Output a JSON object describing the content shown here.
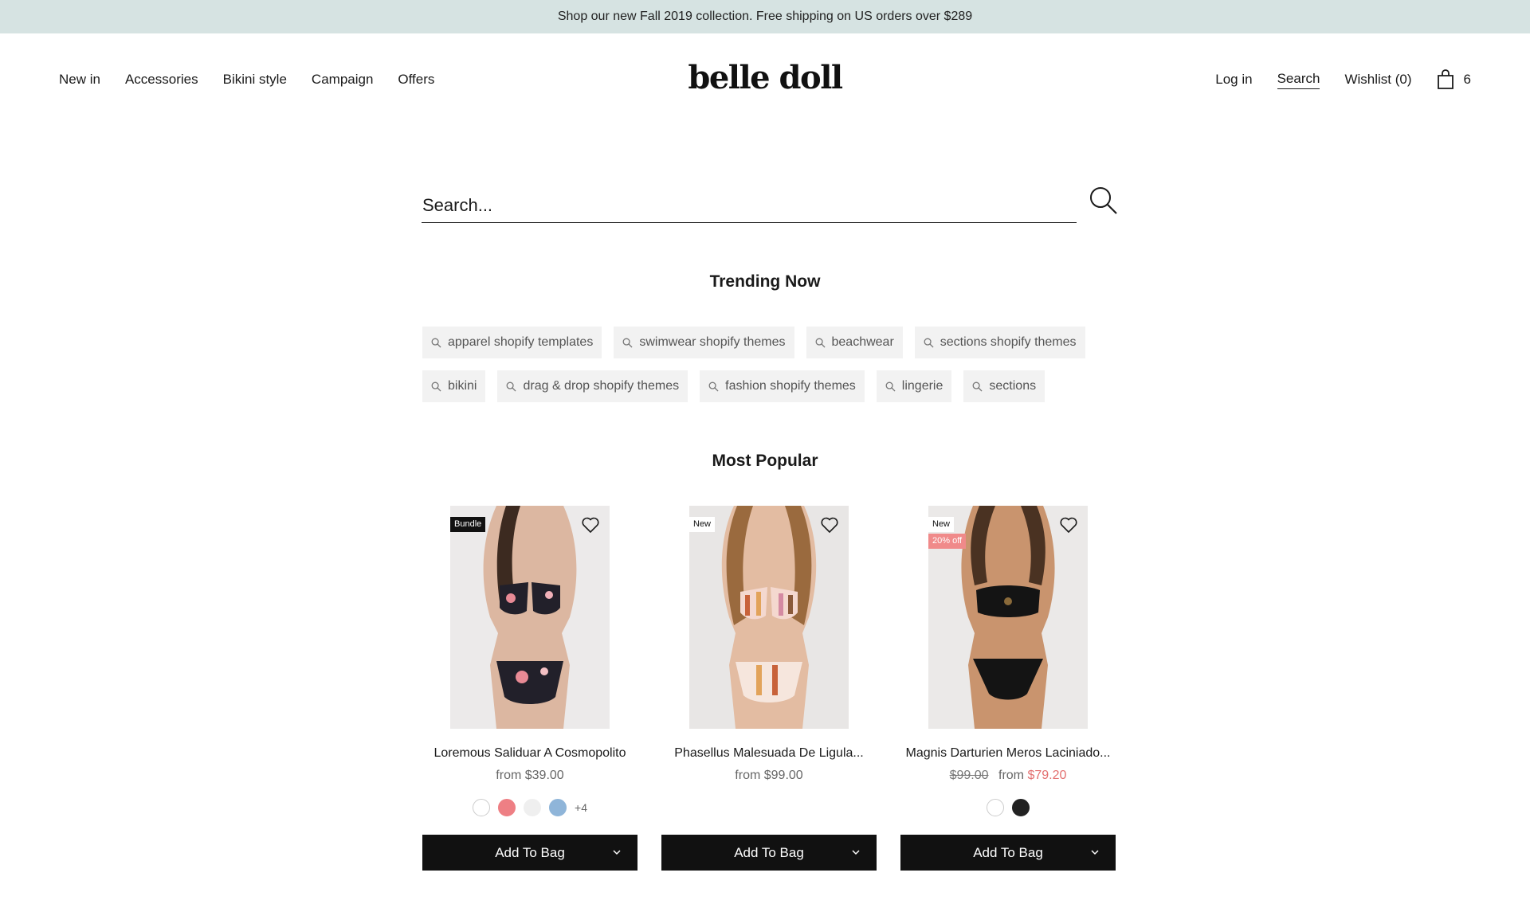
{
  "announcement": "Shop our new Fall 2019 collection. Free shipping on US orders over $289",
  "header": {
    "logo": "belle doll",
    "nav_left": [
      "New in",
      "Accessories",
      "Bikini style",
      "Campaign",
      "Offers"
    ],
    "login": "Log in",
    "search": "Search",
    "wishlist": "Wishlist (0)",
    "cart_count": "6"
  },
  "search": {
    "placeholder": "Search..."
  },
  "trending": {
    "title": "Trending Now",
    "row1": [
      "apparel shopify templates",
      "swimwear shopify themes",
      "beachwear",
      "sections shopify themes"
    ],
    "row2": [
      "bikini",
      "drag & drop shopify themes",
      "fashion shopify themes",
      "lingerie",
      "sections"
    ]
  },
  "popular": {
    "title": "Most Popular",
    "add_label": "Add To Bag",
    "products": [
      {
        "title": "Loremous Saliduar A Cosmopolito",
        "price": "from $39.00",
        "badges": [
          "Bundle"
        ],
        "swatches": [
          "#ffffff",
          "#ee7f84",
          "#efefef",
          "#8fb5d9"
        ],
        "more": "+4"
      },
      {
        "title": "Phasellus Malesuada De Ligula...",
        "price": "from $99.00",
        "badges": [
          "New"
        ],
        "swatches": [],
        "more": ""
      },
      {
        "title": "Magnis Darturien Meros Laciniado...",
        "old_price": "$99.00",
        "price_prefix": "from",
        "sale_price": "$79.20",
        "badges": [
          "New",
          "20% off"
        ],
        "swatches": [
          "#ffffff",
          "#222222"
        ],
        "more": ""
      }
    ]
  },
  "colors": {
    "announce_bg": "#d6e3e2",
    "button_bg": "#111111",
    "sale": "#e36f6f"
  }
}
